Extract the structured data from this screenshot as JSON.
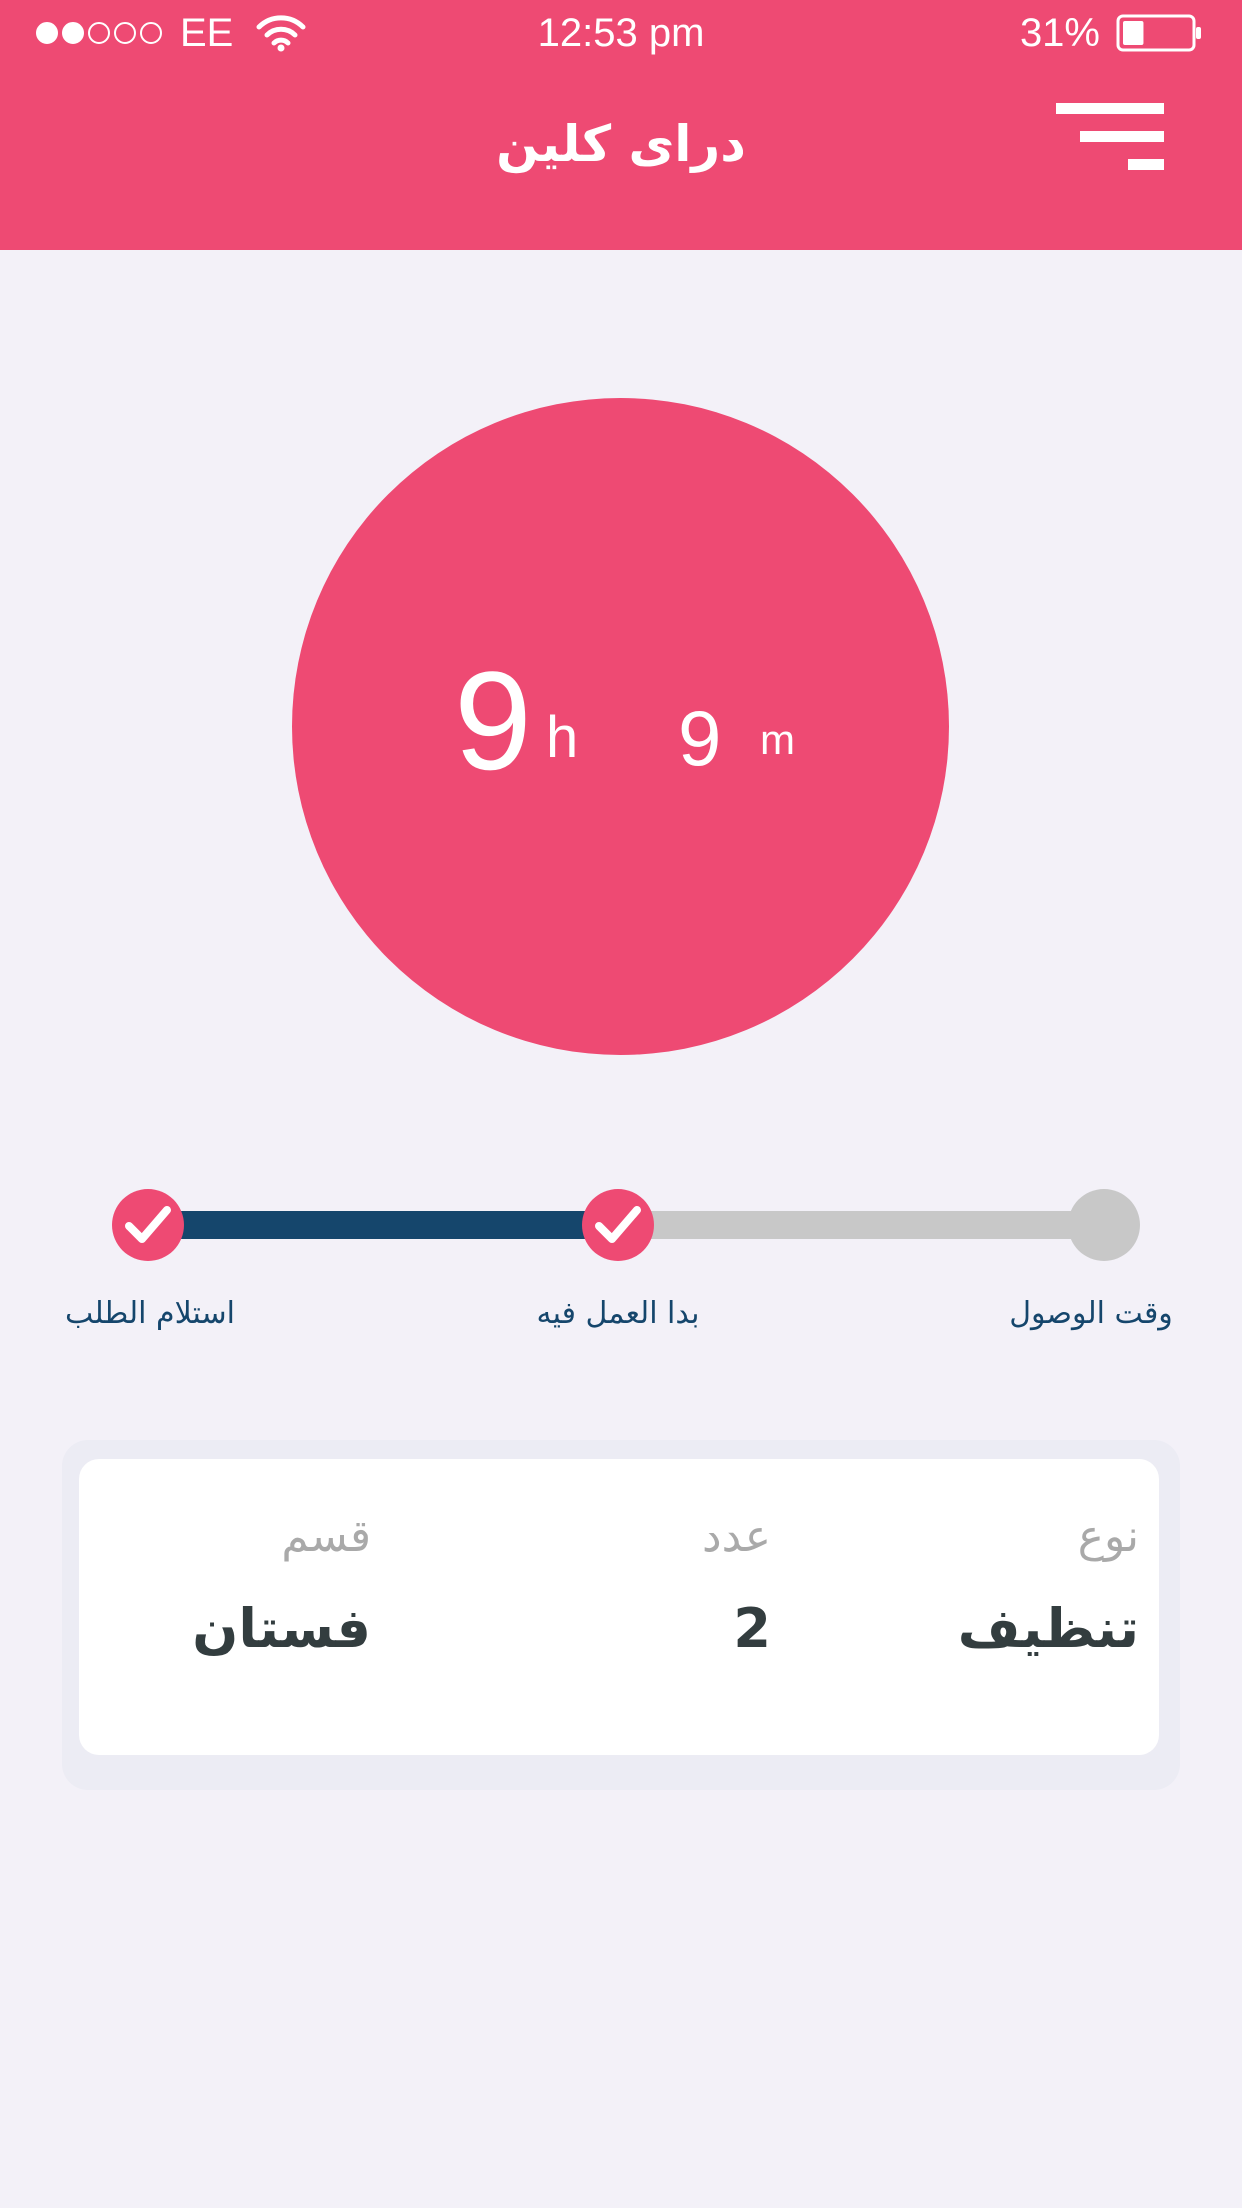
{
  "status_bar": {
    "carrier": "EE",
    "time": "12:53 pm",
    "battery_percent": "31%",
    "signal_strength": 2,
    "signal_max": 5,
    "battery_level": 0.31
  },
  "header": {
    "title": "دراى كلين",
    "menu_icon": "menu-icon",
    "background_color": "#ee4a73"
  },
  "timer": {
    "hours_value": "9",
    "hours_unit": "h",
    "minutes_value": "9",
    "minutes_unit": "m",
    "circle_color": "#ee4a73"
  },
  "progress": {
    "completed_fraction": 0.45,
    "filled_color": "#15466c",
    "track_color": "#c8c8c8",
    "steps": [
      {
        "label": "استلام الطلب",
        "status": "done",
        "icon": "check-icon"
      },
      {
        "label": "بدا العمل فيه",
        "status": "done",
        "icon": "check-icon"
      },
      {
        "label": "وقت الوصول",
        "status": "pending"
      }
    ]
  },
  "order_details": {
    "type_label": "نوع",
    "type_value": "تنظيف",
    "count_label": "عدد",
    "count_value": "2",
    "category_label": "قسم",
    "category_value": "فستان"
  }
}
